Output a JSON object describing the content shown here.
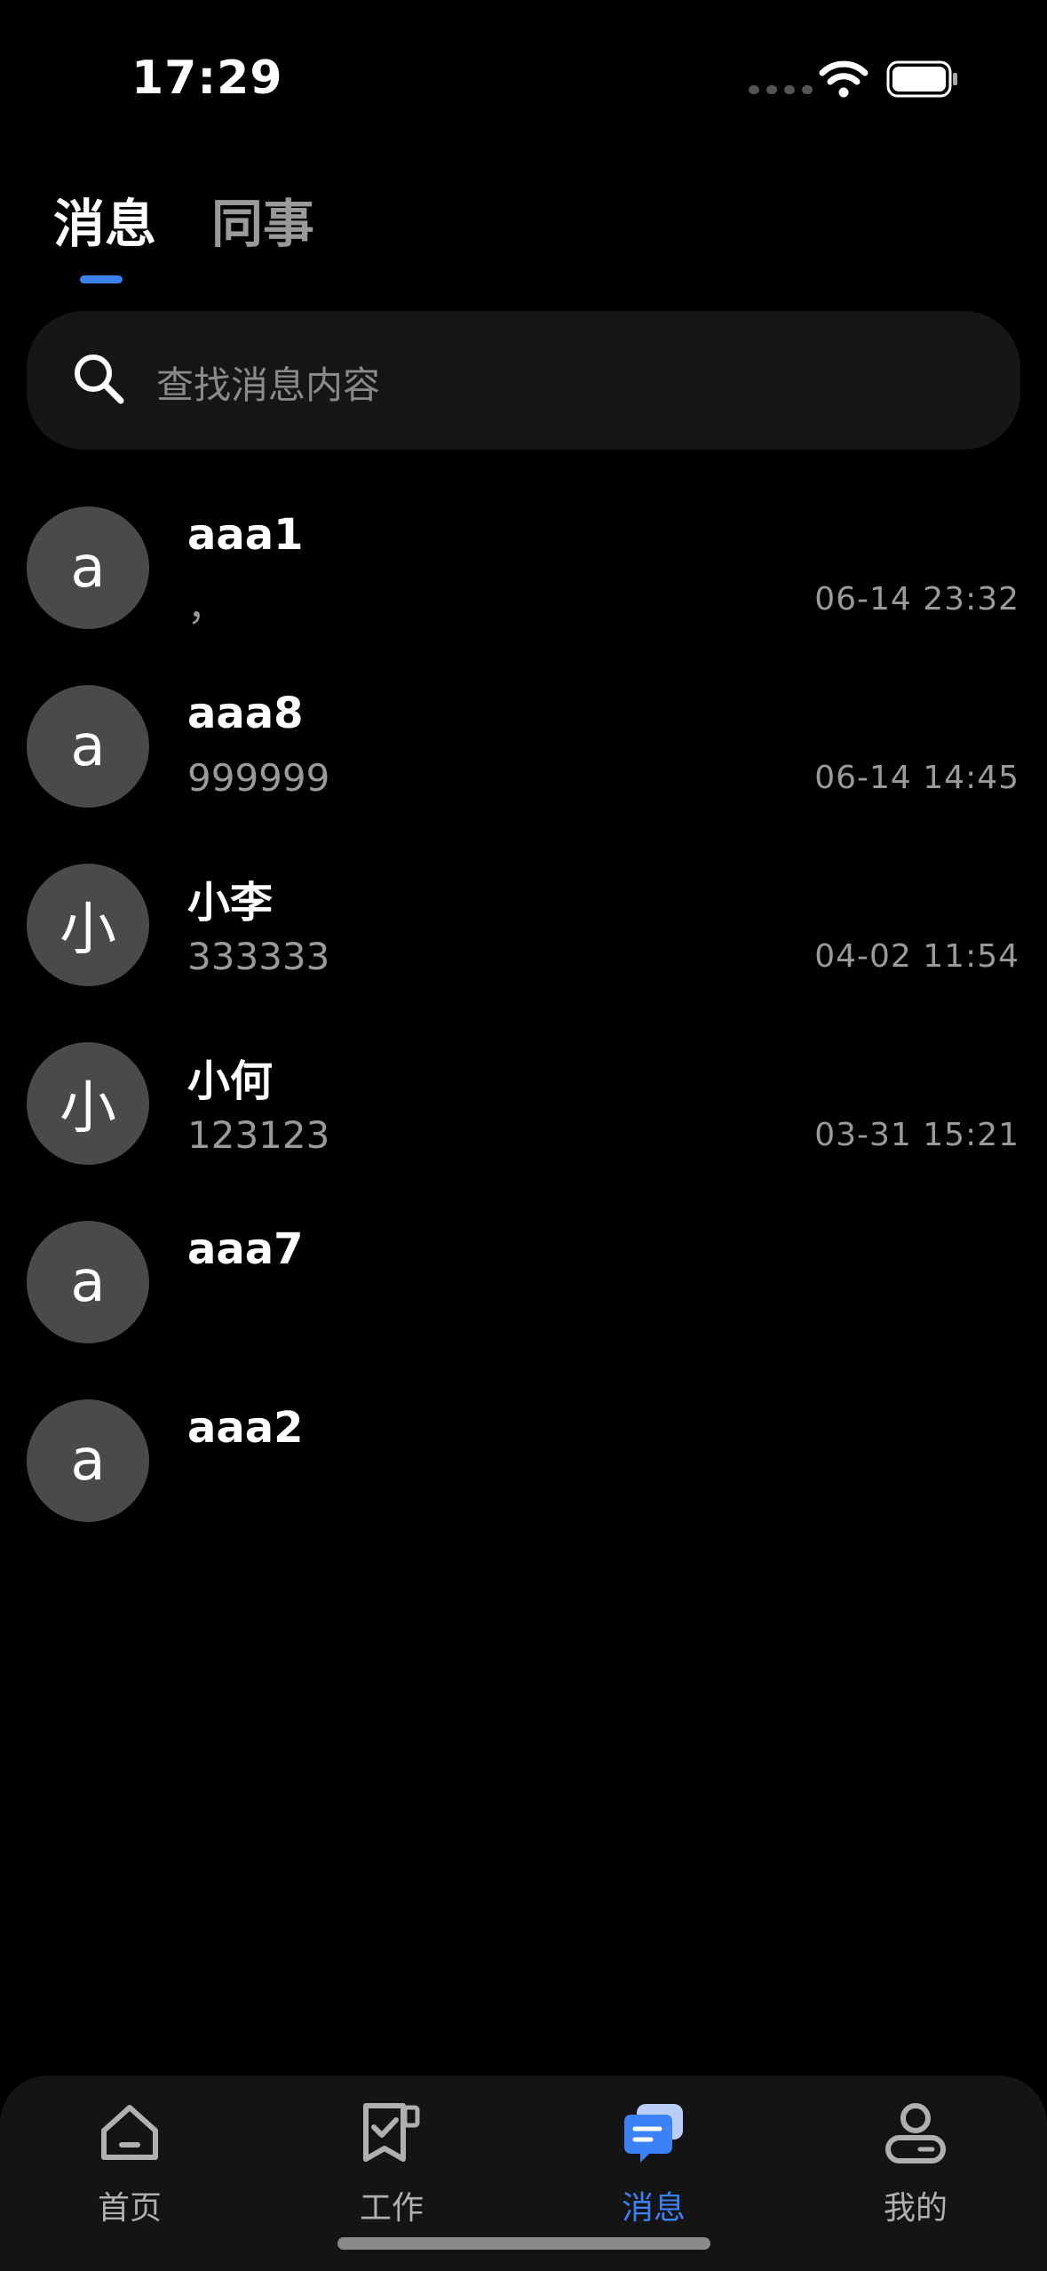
{
  "status_bar": {
    "time": "17:29"
  },
  "tabs": [
    {
      "label": "消息",
      "active": true
    },
    {
      "label": "同事",
      "active": false
    }
  ],
  "search": {
    "placeholder": "查找消息内容"
  },
  "conversations": [
    {
      "avatar": "a",
      "name": "aaa1",
      "preview": "，",
      "time": "06-14 23:32"
    },
    {
      "avatar": "a",
      "name": "aaa8",
      "preview": "999999",
      "time": "06-14 14:45"
    },
    {
      "avatar": "小",
      "name": "小李",
      "preview": "333333",
      "time": "04-02 11:54"
    },
    {
      "avatar": "小",
      "name": "小何",
      "preview": "123123",
      "time": "03-31 15:21"
    },
    {
      "avatar": "a",
      "name": "aaa7",
      "preview": "",
      "time": ""
    },
    {
      "avatar": "a",
      "name": "aaa2",
      "preview": "",
      "time": ""
    }
  ],
  "bottom_nav": [
    {
      "label": "首页",
      "icon": "home-icon"
    },
    {
      "label": "工作",
      "icon": "work-icon"
    },
    {
      "label": "消息",
      "icon": "message-icon",
      "active": true
    },
    {
      "label": "我的",
      "icon": "profile-icon"
    }
  ],
  "colors": {
    "accent": "#3b82f6",
    "background": "#000000",
    "avatar": "#4a4a4a"
  }
}
